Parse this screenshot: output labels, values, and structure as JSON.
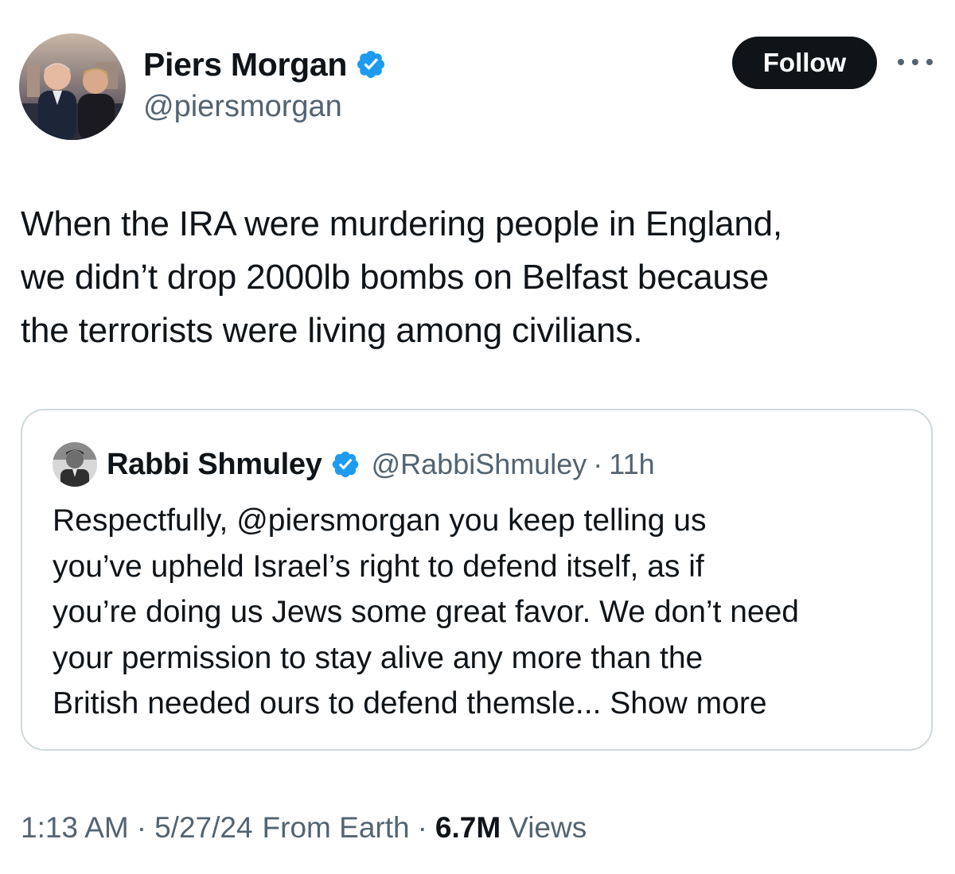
{
  "tweet": {
    "author": {
      "display_name": "Piers Morgan",
      "handle": "@piersmorgan",
      "verified": true,
      "avatar_icon": "profile-photo"
    },
    "follow_label": "Follow",
    "more_icon": "ellipsis-icon",
    "text": "When the IRA were murdering people in England,\nwe didn’t drop 2000lb bombs on Belfast because\nthe terrorists were living among civilians.",
    "quote": {
      "display_name": "Rabbi Shmuley",
      "handle": "@RabbiShmuley",
      "separator": "·",
      "time": "11h",
      "verified": true,
      "text": "Respectfully, @piersmorgan you keep telling us\nyou’ve upheld Israel’s right to defend itself, as if\nyou’re doing us Jews some great favor. We don’t need\nyour permission to stay alive any more than the\nBritish needed ours to defend  themsle...",
      "show_more": "Show more"
    },
    "meta": {
      "time": "1:13 AM",
      "separator": "·",
      "date": "5/27/24",
      "source": "From Earth",
      "views_count": "6.7M",
      "views_label": "Views"
    }
  },
  "colors": {
    "text_primary": "#0f1419",
    "text_secondary": "#536471",
    "verified_blue": "#1d9bf0",
    "border": "#cfd9de",
    "button_bg": "#0f1419"
  }
}
